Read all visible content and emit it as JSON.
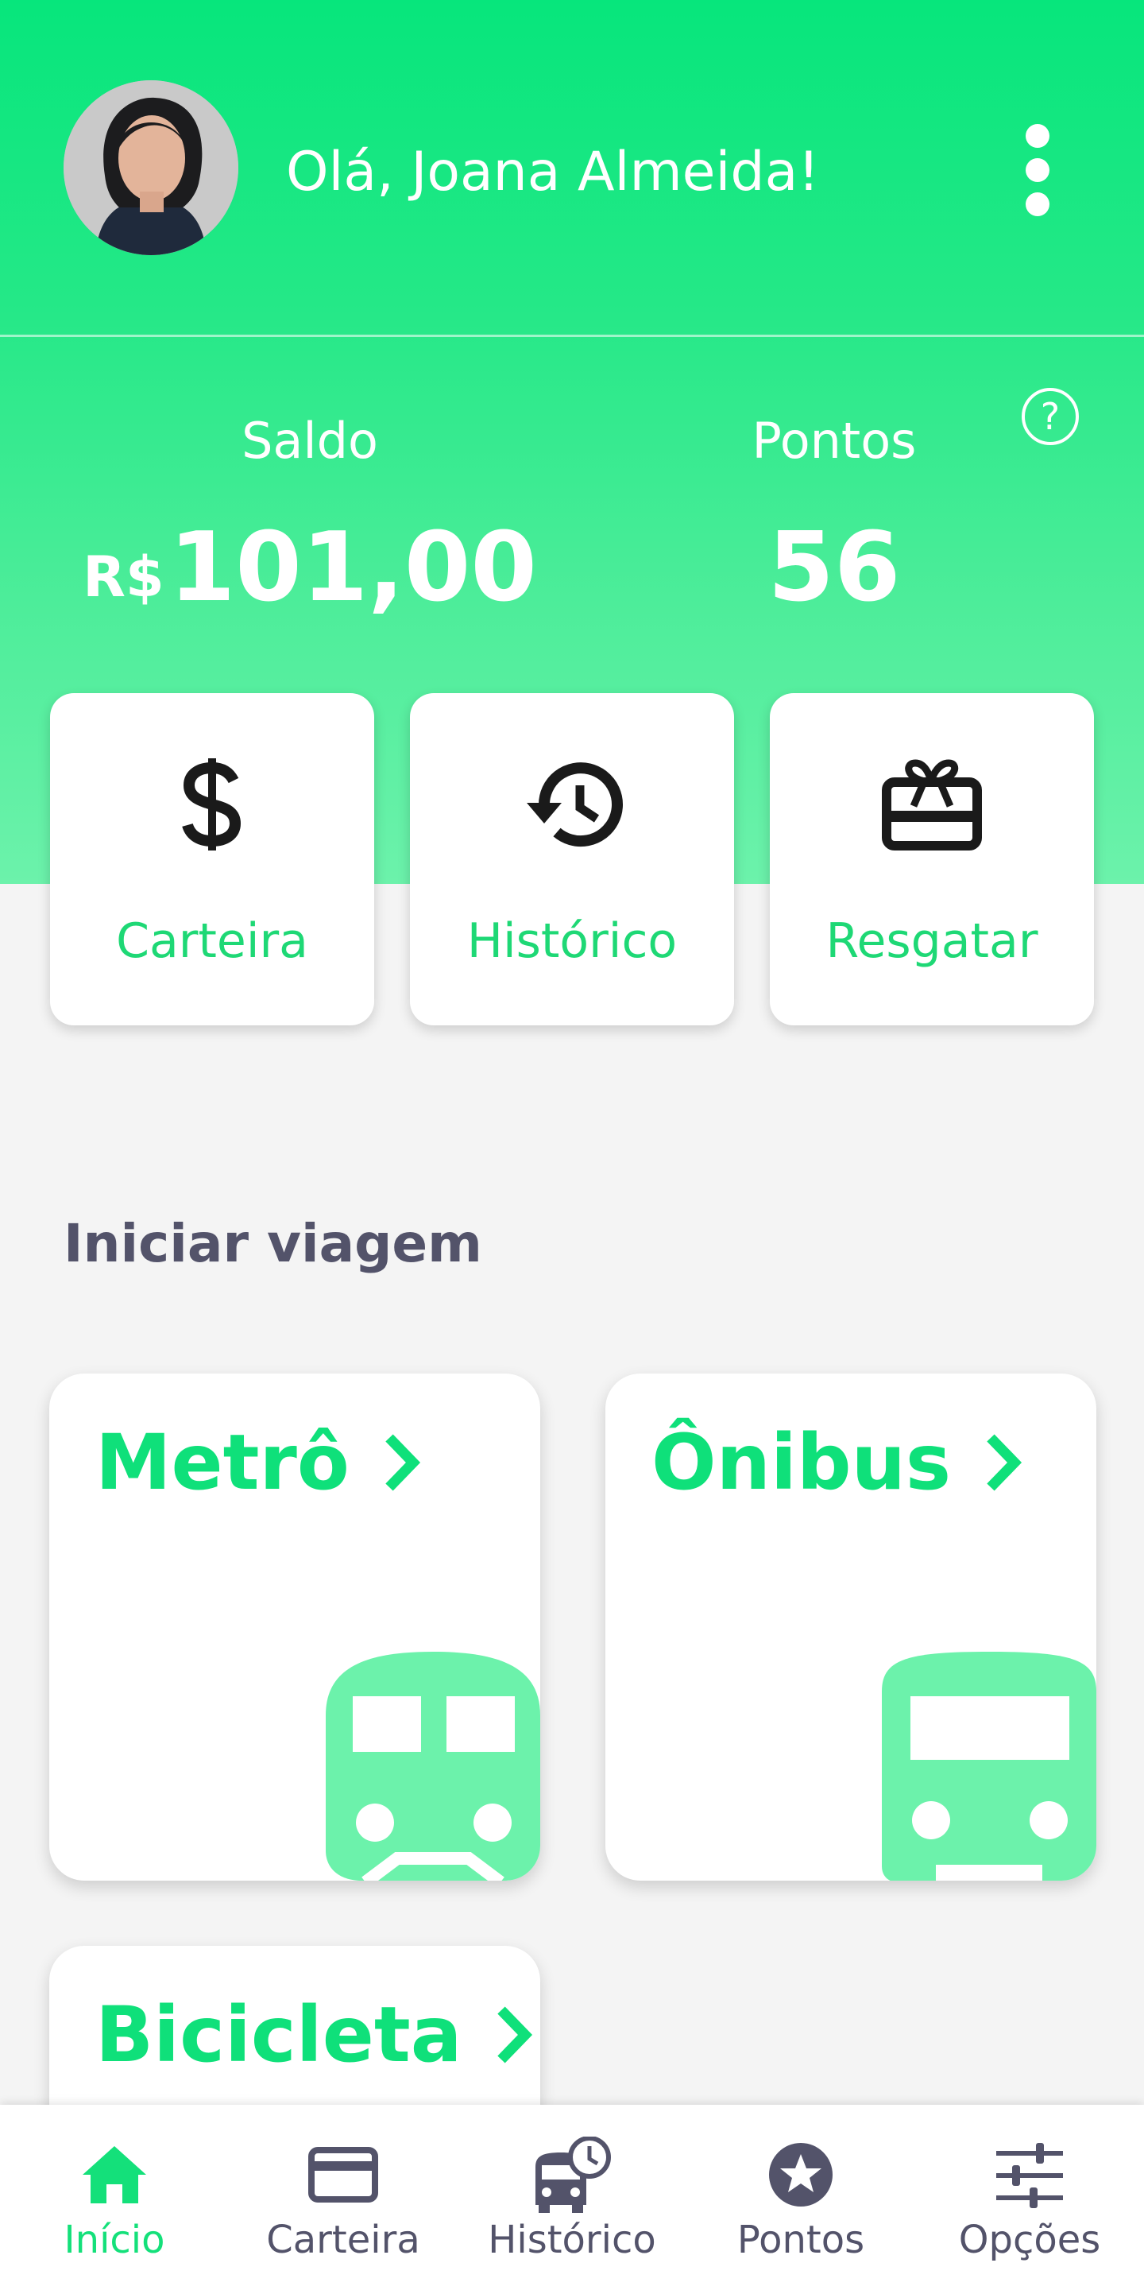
{
  "colors": {
    "brand_green": "#07e67c",
    "accent_text_green": "#1ed875",
    "light_green_art": "#6cf2ab",
    "nav_inactive": "#53536a",
    "background": "#f4f4f4"
  },
  "header": {
    "greeting": "Olá, Joana Almeida!",
    "avatar_icon": "user-avatar-photo",
    "menu_icon": "more-vertical-icon"
  },
  "balance": {
    "help_icon": "help-circle-icon",
    "help_symbol": "?",
    "saldo_label": "Saldo",
    "saldo_currency": "R$",
    "saldo_amount": "101,00",
    "pontos_label": "Pontos",
    "pontos_value": "56"
  },
  "quick_actions": [
    {
      "label": "Carteira",
      "icon": "dollar-icon"
    },
    {
      "label": "Histórico",
      "icon": "history-icon"
    },
    {
      "label": "Resgatar",
      "icon": "gift-card-icon"
    }
  ],
  "trip_section": {
    "title": "Iniciar viagem",
    "options": [
      {
        "label": "Metrô",
        "icon": "train-icon"
      },
      {
        "label": "Ônibus",
        "icon": "bus-icon"
      },
      {
        "label": "Bicicleta",
        "icon": "bicycle-icon"
      }
    ]
  },
  "bottom_nav": [
    {
      "label": "Início",
      "icon": "home-icon",
      "active": true
    },
    {
      "label": "Carteira",
      "icon": "credit-card-icon",
      "active": false
    },
    {
      "label": "Histórico",
      "icon": "bus-clock-icon",
      "active": false
    },
    {
      "label": "Pontos",
      "icon": "star-badge-icon",
      "active": false
    },
    {
      "label": "Opções",
      "icon": "sliders-icon",
      "active": false
    }
  ]
}
